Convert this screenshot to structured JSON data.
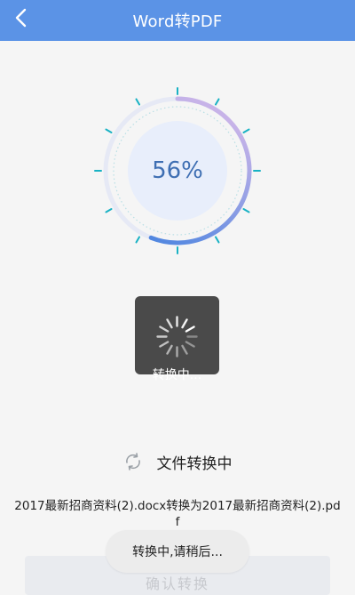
{
  "header": {
    "title": "Word转PDF",
    "back_icon": "chevron-left-icon"
  },
  "progress": {
    "value": 56,
    "label": "56%",
    "track_color": "#e6e9f5",
    "arc_color_start": "#4f86e0",
    "arc_color_end": "#c7b3e8",
    "tick_color": "#19b2c4",
    "inner_color": "#e8eefb"
  },
  "loading_dialog": {
    "text": "转换中...",
    "spinner_icon": "spinner-icon"
  },
  "status": {
    "icon": "refresh-icon",
    "text": "文件转换中"
  },
  "file": {
    "description": "2017最新招商资料(2).docx转换为2017最新招商资料(2).pdf"
  },
  "toast": {
    "text": "转换中,请稍后..."
  },
  "actions": {
    "confirm_label": "确认转换"
  },
  "colors": {
    "header_bg": "#5b93e6",
    "page_bg": "#f5f5f5"
  }
}
